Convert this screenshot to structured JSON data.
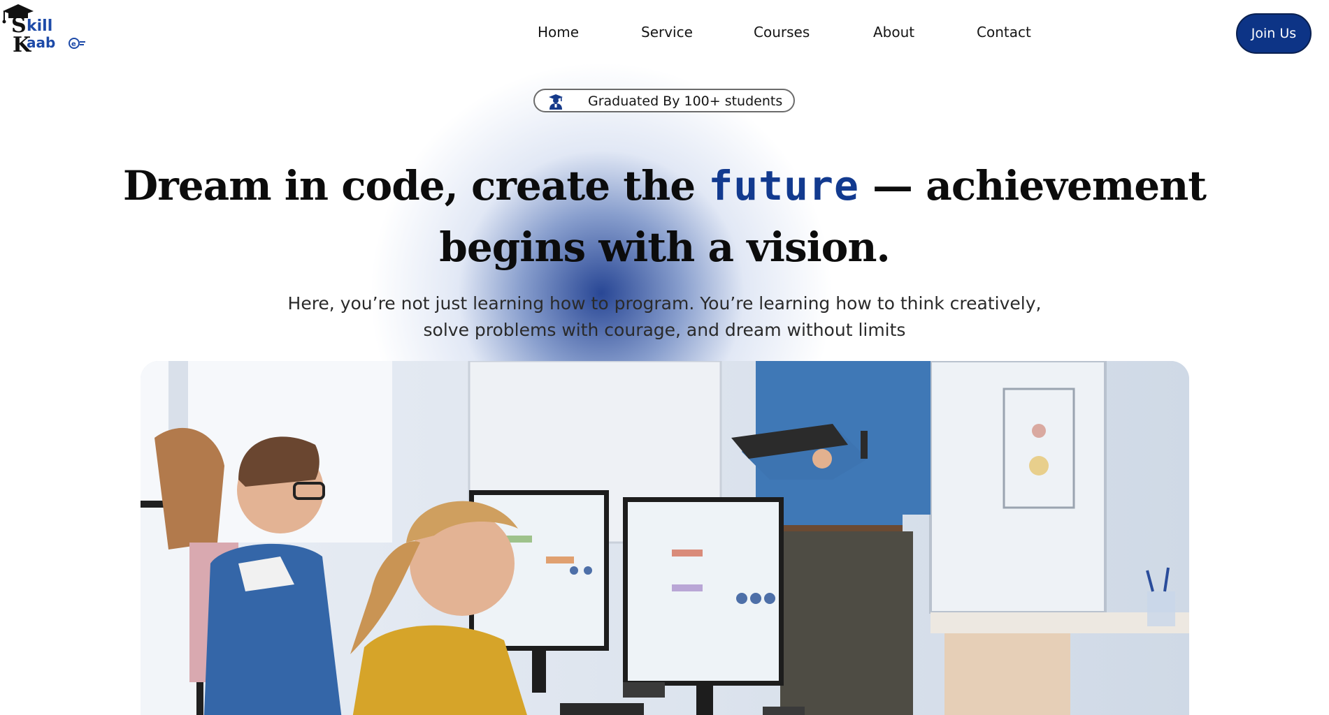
{
  "brand": {
    "logo_line1": "Skill",
    "logo_line2": "Kaab",
    "name": "Skill Kaabe"
  },
  "nav": {
    "items": [
      {
        "label": "Home"
      },
      {
        "label": "Service"
      },
      {
        "label": "Courses"
      },
      {
        "label": "About"
      },
      {
        "label": "Contact"
      }
    ],
    "join_label": "Join Us"
  },
  "badge": {
    "icon": "graduate-icon",
    "text": "Graduated By 100+ students"
  },
  "hero": {
    "headline_part1": "Dream in code, create the ",
    "headline_accent": "future",
    "headline_part2": " — achievement begins with a vision.",
    "subtext_line1": "Here, you’re not just learning how to program. You’re learning how to think creatively,",
    "subtext_line2": "solve problems with courage, and dream without limits",
    "image_subject": "classroom-coding-students"
  },
  "colors": {
    "accent": "#0d3486",
    "glow": "#16378c",
    "text": "#111111"
  }
}
